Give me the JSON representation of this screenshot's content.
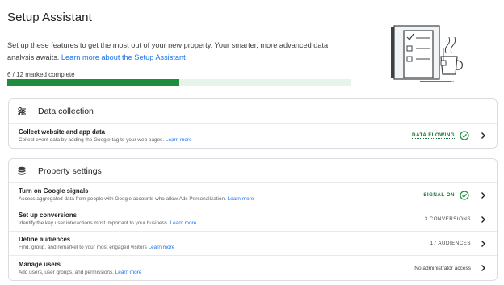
{
  "page": {
    "title": "Setup Assistant",
    "intro_text": "Set up these features to get the most out of your new property. Your smarter, more advanced data analysis awaits.",
    "intro_link": "Learn more about the Setup Assistant"
  },
  "progress": {
    "label": "6 / 12 marked complete",
    "completed": 6,
    "total": 12
  },
  "colors": {
    "accent": "#1a73e8",
    "progress_fill": "#1e8e3e",
    "progress_track": "#e6f4ea",
    "status_green": "#137333"
  },
  "sections": {
    "data_collection": {
      "title": "Data collection",
      "icon": "data-collection-icon",
      "items": [
        {
          "title": "Collect website and app data",
          "description": "Collect event data by adding the Google tag to your web pages.",
          "link": "Learn more",
          "status": "DATA FLOWING",
          "status_icon": "check-circle-icon"
        }
      ]
    },
    "property_settings": {
      "title": "Property settings",
      "icon": "database-icon",
      "items": [
        {
          "title": "Turn on Google signals",
          "description": "Access aggregated data from people with Google accounts who allow Ads Personalization.",
          "link": "Learn more",
          "status": "SIGNAL ON",
          "status_icon": "check-circle-icon"
        },
        {
          "title": "Set up conversions",
          "description": "Identify the key user interactions most important to your business.",
          "link": "Learn more",
          "status": "3 CONVERSIONS"
        },
        {
          "title": "Define audiences",
          "description": "Find, group, and remarket to your most engaged visitors",
          "link": "Learn more",
          "status": "17 AUDIENCES"
        },
        {
          "title": "Manage users",
          "description": "Add users, user groups, and permissions.",
          "link": "Learn more",
          "status": "No administrator access"
        }
      ]
    }
  }
}
